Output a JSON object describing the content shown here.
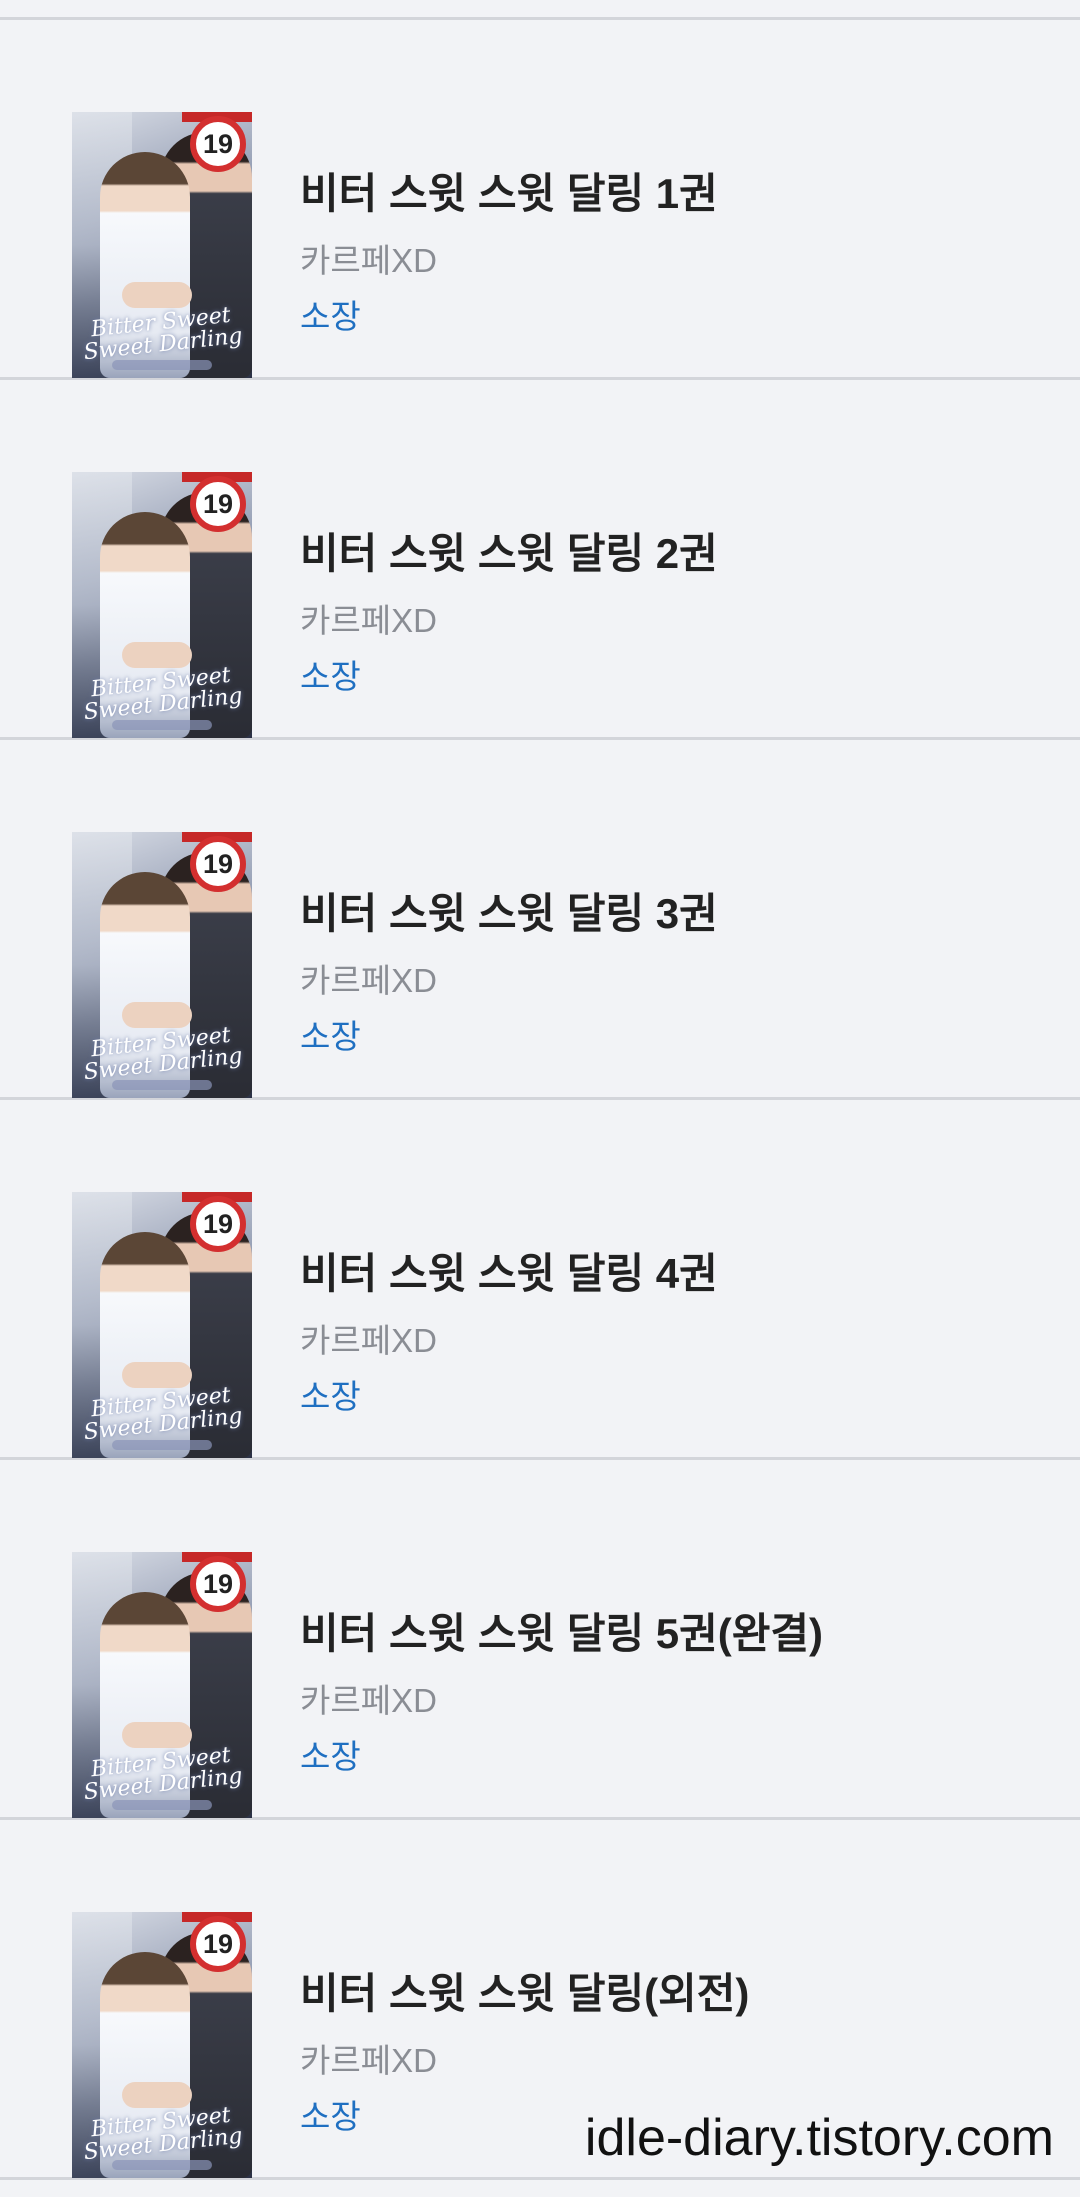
{
  "books": [
    {
      "title": "비터 스윗 스윗 달링 1권",
      "author": "카르페XD",
      "status": "소장",
      "age_rating": "19",
      "cover_script": "Bitter Sweet Sweet Darling"
    },
    {
      "title": "비터 스윗 스윗 달링 2권",
      "author": "카르페XD",
      "status": "소장",
      "age_rating": "19",
      "cover_script": "Bitter Sweet Sweet Darling"
    },
    {
      "title": "비터 스윗 스윗 달링 3권",
      "author": "카르페XD",
      "status": "소장",
      "age_rating": "19",
      "cover_script": "Bitter Sweet Sweet Darling"
    },
    {
      "title": "비터 스윗 스윗 달링 4권",
      "author": "카르페XD",
      "status": "소장",
      "age_rating": "19",
      "cover_script": "Bitter Sweet Sweet Darling"
    },
    {
      "title": "비터 스윗 스윗 달링 5권(완결)",
      "author": "카르페XD",
      "status": "소장",
      "age_rating": "19",
      "cover_script": "Bitter Sweet Sweet Darling"
    },
    {
      "title": "비터 스윗 스윗 달링(외전)",
      "author": "카르페XD",
      "status": "소장",
      "age_rating": "19",
      "cover_script": "Bitter Sweet Sweet Darling"
    }
  ],
  "watermark": "idle-diary.tistory.com",
  "colors": {
    "background": "#f2f3f6",
    "divider": "#d3d5da",
    "title": "#222222",
    "author": "#8a8d94",
    "status": "#1f6fc1",
    "badge_ring": "#d32f2f"
  }
}
